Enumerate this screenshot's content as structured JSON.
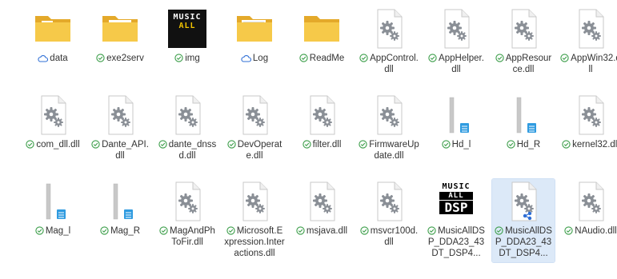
{
  "colors": {
    "folder_main": "#f6c949",
    "folder_back": "#e4a92a",
    "status_green": "#3a9d48",
    "cloud_blue": "#2f6fd6",
    "selected_bg": "#dce9f8"
  },
  "files": [
    {
      "name": "data",
      "type": "folder",
      "status": "cloud",
      "preview": "image"
    },
    {
      "name": "exe2serv",
      "type": "folder",
      "status": "synced",
      "preview": "blue"
    },
    {
      "name": "img",
      "type": "image-music",
      "status": "synced"
    },
    {
      "name": "Log",
      "type": "folder",
      "status": "cloud",
      "preview": "doc"
    },
    {
      "name": "ReadMe",
      "type": "folder",
      "status": "synced",
      "preview": "none"
    },
    {
      "name": "AppControl.dll",
      "type": "dll",
      "status": "synced"
    },
    {
      "name": "AppHelper.dll",
      "type": "dll",
      "status": "synced"
    },
    {
      "name": "AppResource.dll",
      "type": "dll",
      "status": "synced"
    },
    {
      "name": "AppWin32.dll",
      "type": "dll",
      "status": "synced"
    },
    {
      "name": "com_dll.dll",
      "type": "dll",
      "status": "synced"
    },
    {
      "name": "Dante_API.dll",
      "type": "dll",
      "status": "synced"
    },
    {
      "name": "dante_dnssd.dll",
      "type": "dll",
      "status": "synced"
    },
    {
      "name": "DevOperate.dll",
      "type": "dll",
      "status": "synced"
    },
    {
      "name": "filter.dll",
      "type": "dll",
      "status": "synced"
    },
    {
      "name": "FirmwareUpdate.dll",
      "type": "dll",
      "status": "synced"
    },
    {
      "name": "Hd_l",
      "type": "bar-file",
      "status": "synced"
    },
    {
      "name": "Hd_R",
      "type": "bar-file",
      "status": "synced"
    },
    {
      "name": "kernel32.dll",
      "type": "dll",
      "status": "synced"
    },
    {
      "name": "Mag_l",
      "type": "bar-file",
      "status": "synced"
    },
    {
      "name": "Mag_R",
      "type": "bar-file",
      "status": "synced"
    },
    {
      "name": "MagAndPhToFir.dll",
      "type": "dll",
      "status": "synced"
    },
    {
      "name": "Microsoft.Expression.Interactions.dll",
      "type": "dll",
      "status": "synced"
    },
    {
      "name": "msjava.dll",
      "type": "dll",
      "status": "synced"
    },
    {
      "name": "msvcr100d.dll",
      "type": "dll",
      "status": "synced"
    },
    {
      "name": "MusicAllDSP_DDA23_43DT_DSP4...",
      "type": "music-exe",
      "status": "synced"
    },
    {
      "name": "MusicAllDSP_DDA23_43DT_DSP4...",
      "type": "dll-share",
      "status": "synced",
      "selected": true
    },
    {
      "name": "NAudio.dll",
      "type": "dll",
      "status": "synced"
    }
  ],
  "logo_text": {
    "line1": "MUSIC",
    "line2": "ALL",
    "line3": "DSP"
  }
}
